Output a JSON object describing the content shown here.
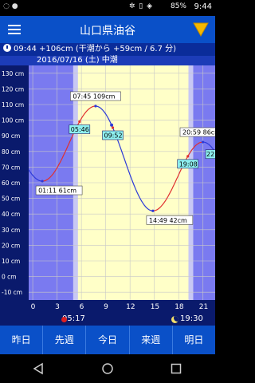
{
  "status_bar": {
    "left": "◌ ●",
    "icons": "✲ ▯ ◈",
    "battery": "85%",
    "time": "9:44"
  },
  "header": {
    "title": "山口県油谷"
  },
  "info": {
    "text": "09:44 +106cm (干潮から +59cm / 6.7 分)"
  },
  "chart_data": {
    "type": "line",
    "title": "2016/07/16 (土) 中潮",
    "y_unit": "cm",
    "ylim": [
      -15,
      135
    ],
    "y_ticks": [
      {
        "v": 130,
        "label": "130 cm"
      },
      {
        "v": 120,
        "label": "120 cm"
      },
      {
        "v": 110,
        "label": "110 cm"
      },
      {
        "v": 100,
        "label": "100 cm"
      },
      {
        "v": 90,
        "label": "90 cm"
      },
      {
        "v": 80,
        "label": "80 cm"
      },
      {
        "v": 70,
        "label": "70 cm"
      },
      {
        "v": 60,
        "label": "60 cm"
      },
      {
        "v": 50,
        "label": "50 cm"
      },
      {
        "v": 40,
        "label": "40 cm"
      },
      {
        "v": 30,
        "label": "30 cm"
      },
      {
        "v": 20,
        "label": "20 cm"
      },
      {
        "v": 10,
        "label": "10 cm"
      },
      {
        "v": 0,
        "label": "0 cm"
      },
      {
        "v": -10,
        "label": "-10 cm"
      }
    ],
    "xlim": [
      -0.5,
      22.5
    ],
    "x_ticks": [
      {
        "v": 0,
        "label": "0"
      },
      {
        "v": 3,
        "label": "3"
      },
      {
        "v": 6,
        "label": "6"
      },
      {
        "v": 9,
        "label": "9"
      },
      {
        "v": 12,
        "label": "12"
      },
      {
        "v": 15,
        "label": "15"
      },
      {
        "v": 18,
        "label": "18"
      },
      {
        "v": 21,
        "label": "21"
      }
    ],
    "sunrise_h": 5.28,
    "sunset_h": 19.5,
    "current_time_h": 9.73,
    "tide_points": [
      {
        "t": 1.18,
        "h": 61,
        "label": "01:11 61cm",
        "type": "low"
      },
      {
        "t": 7.75,
        "h": 109,
        "label": "07:45 109cm",
        "type": "high"
      },
      {
        "t": 14.82,
        "h": 42,
        "label": "14:49 42cm",
        "type": "low"
      },
      {
        "t": 20.98,
        "h": 86,
        "label": "20:59 86cm",
        "type": "high"
      }
    ],
    "time_marks": [
      {
        "t": 5.77,
        "label": "05:46"
      },
      {
        "t": 9.87,
        "label": "09:52"
      },
      {
        "t": 19.13,
        "label": "19:08"
      }
    ],
    "edge_label": "22",
    "colors": {
      "night": "#7A7AF0",
      "day": "#FFFFC8",
      "rising": "#E03030",
      "falling": "#2C3AD8",
      "grid": "#C8C8C8"
    }
  },
  "sun": {
    "sunrise": "05:17",
    "sunset": "19:30"
  },
  "nav": [
    "昨日",
    "先週",
    "今日",
    "来週",
    "明日"
  ]
}
